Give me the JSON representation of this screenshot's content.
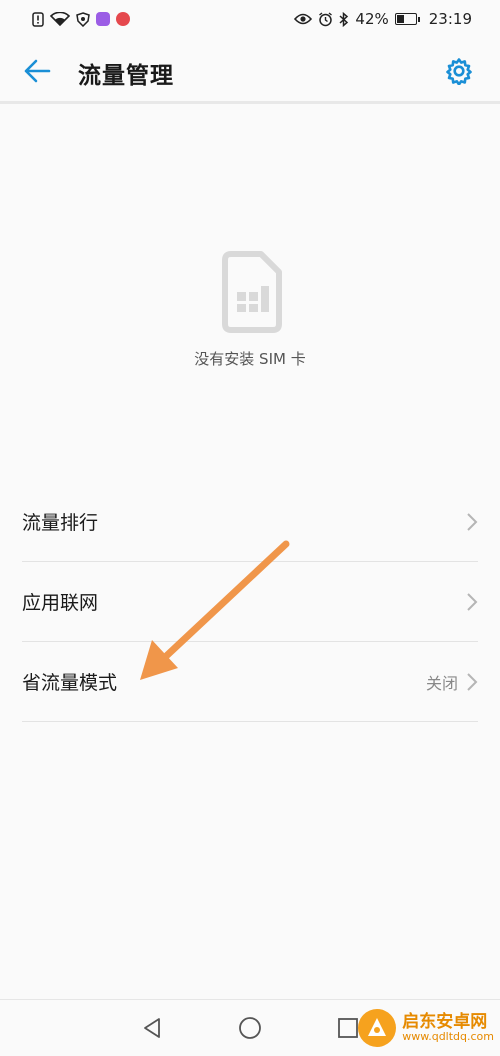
{
  "status_bar": {
    "battery_text": "42%",
    "battery_level": 0.42,
    "time": "23:19"
  },
  "header": {
    "title": "流量管理"
  },
  "empty_state": {
    "message": "没有安装 SIM 卡"
  },
  "list": {
    "items": [
      {
        "label": "流量排行",
        "value": ""
      },
      {
        "label": "应用联网",
        "value": ""
      },
      {
        "label": "省流量模式",
        "value": "关闭"
      }
    ]
  },
  "watermark": {
    "title": "启东安卓网",
    "url": "www.qdltdq.com"
  },
  "colors": {
    "accent": "#1a8fd6",
    "annotation_arrow": "#f0964a",
    "sim_icon": "#d9d9d9",
    "chevron": "#b5b5b5"
  },
  "icons": {
    "back": "arrow-left-icon",
    "settings": "gear-icon",
    "sim": "sim-card-icon",
    "chevron": "chevron-right-icon"
  }
}
